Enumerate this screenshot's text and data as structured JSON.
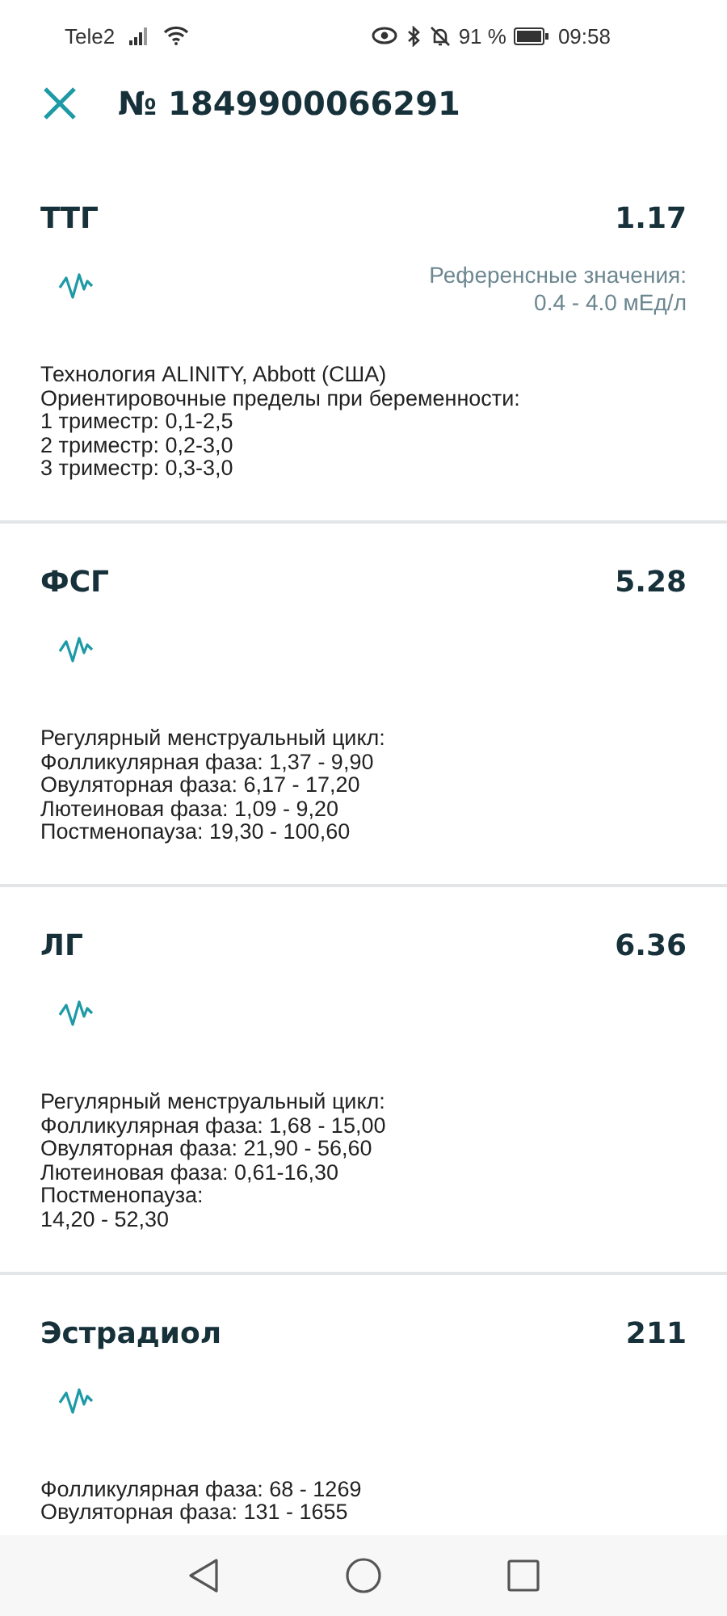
{
  "status_bar": {
    "carrier": "Tele2",
    "battery": "91 %",
    "time": "09:58"
  },
  "header": {
    "title": "№ 1849900066291"
  },
  "tests": [
    {
      "name": "ТТГ",
      "value": "1.17",
      "reference": [
        "Референсные значения:",
        "0.4 - 4.0 мЕд/л"
      ],
      "notes": [
        "Технология ALINITY, Abbott (США)",
        "Ориентировочные пределы при беременности:",
        "1 триместр: 0,1-2,5",
        "2 триместр: 0,2-3,0",
        "3 триместр: 0,3-3,0"
      ]
    },
    {
      "name": "ФСГ",
      "value": "5.28",
      "notes": [
        "Регулярный менструальный цикл:",
        "Фолликулярная фаза: 1,37 - 9,90",
        "Овуляторная фаза: 6,17 - 17,20",
        "Лютеиновая фаза: 1,09 - 9,20",
        "Постменопауза: 19,30 - 100,60"
      ]
    },
    {
      "name": "ЛГ",
      "value": "6.36",
      "notes": [
        "Регулярный менструальный цикл:",
        "Фолликулярная фаза: 1,68 - 15,00",
        "Овуляторная фаза: 21,90 - 56,60",
        "Лютеиновая фаза: 0,61-16,30",
        "Постменопауза:",
        "14,20 - 52,30"
      ]
    },
    {
      "name": "Эстрадиол",
      "value": "211",
      "notes": [
        "Фолликулярная фаза: 68 - 1269",
        "Овуляторная фаза: 131 - 1655"
      ]
    }
  ]
}
